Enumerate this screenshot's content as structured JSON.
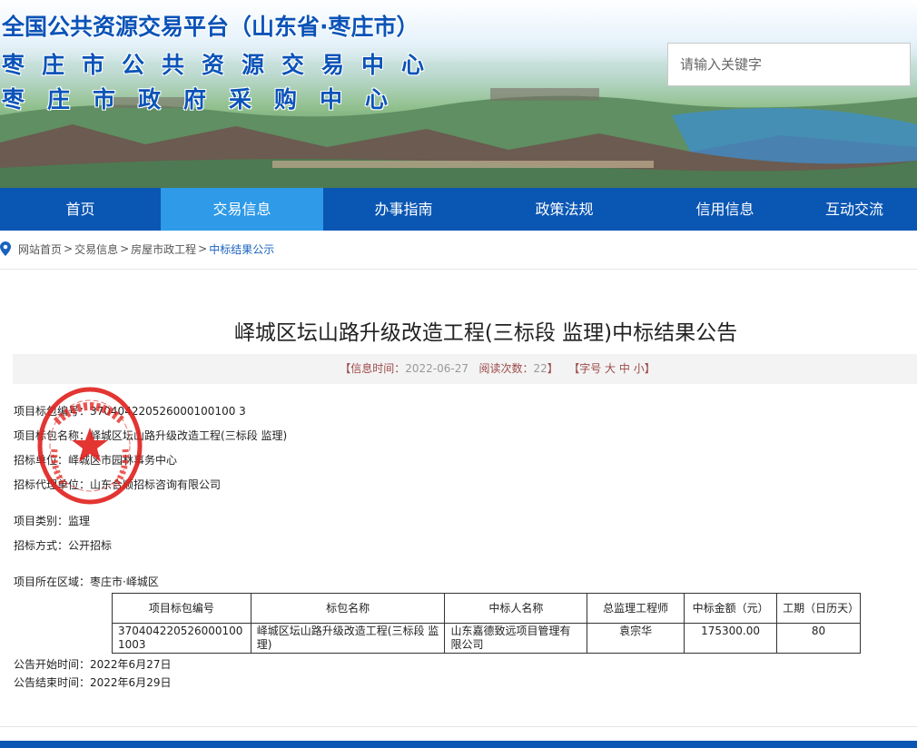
{
  "header": {
    "title_line1": "全国公共资源交易平台（山东省·枣庄市）",
    "title_line2": "枣庄市公共资源交易中心",
    "title_line3": "枣庄市政府采购中心",
    "search_placeholder": "请输入关键字"
  },
  "nav": {
    "items": [
      {
        "label": "首页"
      },
      {
        "label": "交易信息"
      },
      {
        "label": "办事指南"
      },
      {
        "label": "政策法规"
      },
      {
        "label": "信用信息"
      },
      {
        "label": "互动交流"
      }
    ],
    "active_index": 1
  },
  "breadcrumb": {
    "items": [
      "网站首页",
      "交易信息",
      "房屋市政工程",
      "中标结果公示"
    ],
    "separator": ">"
  },
  "article": {
    "title": "峄城区坛山路升级改造工程(三标段 监理)中标结果公告",
    "meta": {
      "info_time_label": "【信息时间：",
      "info_time": "2022-06-27",
      "views_label": "阅读次数：",
      "views": "22",
      "close": "】",
      "font_size_label": "【字号",
      "font_large": "大",
      "font_medium": "中",
      "font_small": "小",
      "font_close": "】"
    },
    "fields": {
      "package_no_label": "项目标包编号：",
      "package_no": "370404220526000100100 3",
      "package_name_label": "项目标包名称：",
      "package_name": "峄城区坛山路升级改造工程(三标段 监理)",
      "tenderer_label": "招标单位：",
      "tenderer": "峄城区市园林事务中心",
      "agent_label": "招标代理单位：",
      "agent": "山东合顺招标咨询有限公司",
      "category_label": "项目类别：",
      "category": "监理",
      "method_label": "招标方式：",
      "method": "公开招标",
      "region_label": "项目所在区域：",
      "region": "枣庄市·峄城区",
      "start_label": "公告开始时间：",
      "start": "2022年6月27日",
      "end_label": "公告结束时间：",
      "end": "2022年6月29日"
    },
    "table": {
      "headers": [
        "项目标包编号",
        "标包名称",
        "中标人名称",
        "总监理工程师",
        "中标金额（元）",
        "工期（日历天）"
      ],
      "rows": [
        [
          "3704042205260001001003",
          "峄城区坛山路升级改造工程(三标段 监理)",
          "山东嘉德致远项目管理有限公司",
          "袁宗华",
          "175300.00",
          "80"
        ]
      ]
    }
  },
  "colors": {
    "nav_bg": "#0a56b3",
    "nav_active": "#2e9ae8",
    "title_blue": "#0a53b8",
    "seal_red": "#e0201c"
  }
}
